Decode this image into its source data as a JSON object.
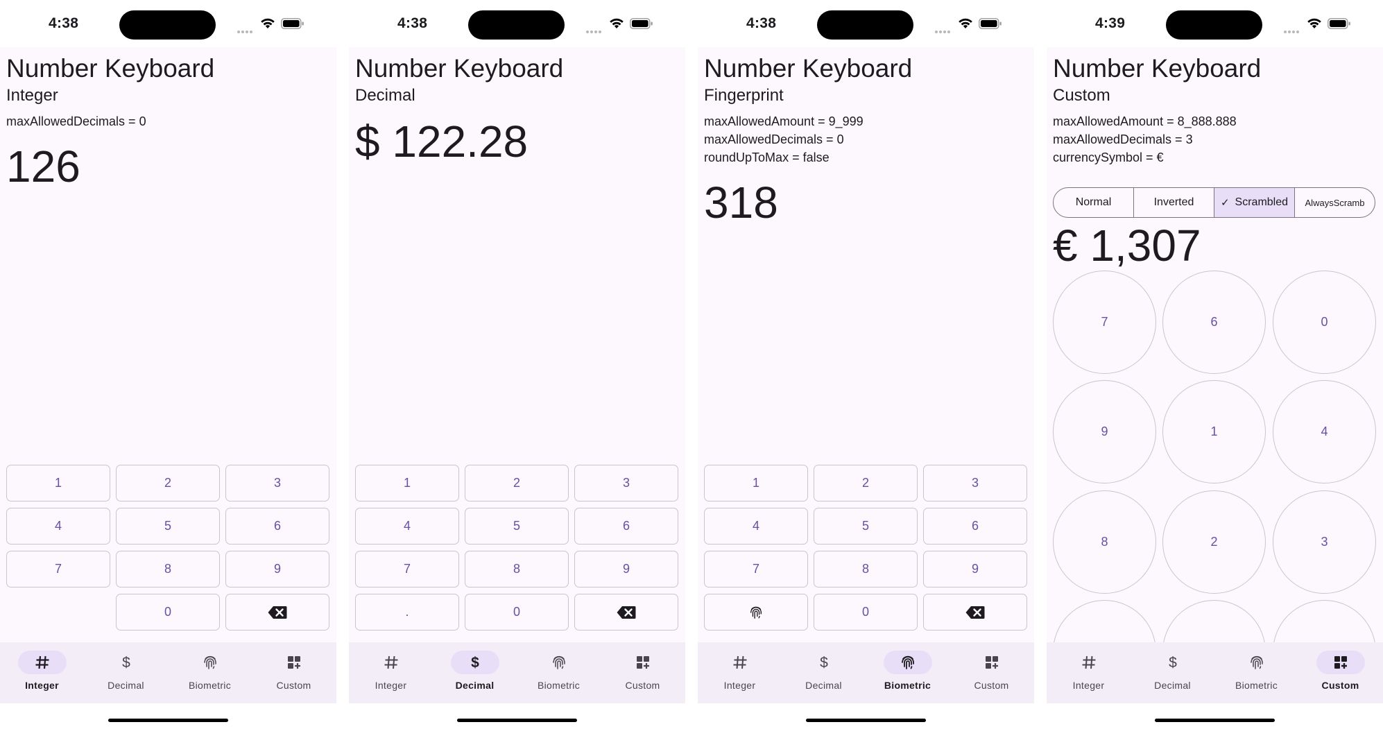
{
  "status_time": [
    "4:38",
    "4:38",
    "4:38",
    "4:39"
  ],
  "app_title": "Number Keyboard",
  "screens": [
    {
      "subtitle": "Integer",
      "params": [
        "maxAllowedDecimals = 0"
      ],
      "amount": "126",
      "keys": [
        "1",
        "2",
        "3",
        "4",
        "5",
        "6",
        "7",
        "8",
        "9",
        "",
        "0",
        "backspace"
      ]
    },
    {
      "subtitle": "Decimal",
      "params": [],
      "amount": "$ 122.28",
      "keys": [
        "1",
        "2",
        "3",
        "4",
        "5",
        "6",
        "7",
        "8",
        "9",
        ".",
        "0",
        "backspace"
      ]
    },
    {
      "subtitle": "Fingerprint",
      "params": [
        "maxAllowedAmount = 9_999",
        "maxAllowedDecimals = 0",
        "roundUpToMax = false"
      ],
      "amount": "318",
      "keys": [
        "1",
        "2",
        "3",
        "4",
        "5",
        "6",
        "7",
        "8",
        "9",
        "fingerprint",
        "0",
        "backspace"
      ]
    },
    {
      "subtitle": "Custom",
      "params": [
        "maxAllowedAmount = 8_888.888",
        "maxAllowedDecimals = 3",
        "currencySymbol = €"
      ],
      "amount": "€ 1,307",
      "segments": [
        "Normal",
        "Inverted",
        "Scrambled",
        "AlwaysScramb"
      ],
      "selected_segment": "Scrambled",
      "keys": [
        "7",
        "6",
        "0",
        "9",
        "1",
        "4",
        "8",
        "2",
        "3",
        "",
        "",
        ""
      ]
    }
  ],
  "nav_items": [
    {
      "label": "Integer",
      "icon": "hash-icon"
    },
    {
      "label": "Decimal",
      "icon": "dollar-icon"
    },
    {
      "label": "Biometric",
      "icon": "fingerprint-icon"
    },
    {
      "label": "Custom",
      "icon": "widgets-add-icon"
    }
  ],
  "colors": {
    "background": "#fdf7fe",
    "primary": "#6750a4",
    "outline": "#cac4d0",
    "nav_background": "#f3edf7",
    "nav_indicator": "#e8def8"
  }
}
